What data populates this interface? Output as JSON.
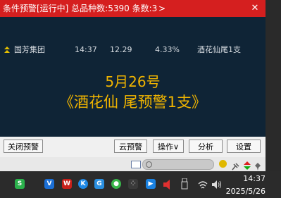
{
  "window": {
    "title": "条件预警[运行中] 总品种数:5390 条数:3",
    "title_arrow": ">",
    "close_glyph": "✕"
  },
  "alert": {
    "name": "国芳集团",
    "time": "14:37",
    "price": "12.29",
    "change": "4.33%",
    "condition": "酒花仙尾1支"
  },
  "message": {
    "line1": "5月26号",
    "line2": "《酒花仙  尾预警1支》"
  },
  "buttons": {
    "close_alert": "关闭预警",
    "cloud_alert": "云预警",
    "operate": "操作∨",
    "analyze": "分析",
    "settings": "设置"
  },
  "taskbar": {
    "time": "14:37",
    "date": "2025/5/26"
  },
  "colors": {
    "title_bg": "#d51f1f",
    "window_bg": "#0f2436",
    "message_text": "#f0b400"
  }
}
